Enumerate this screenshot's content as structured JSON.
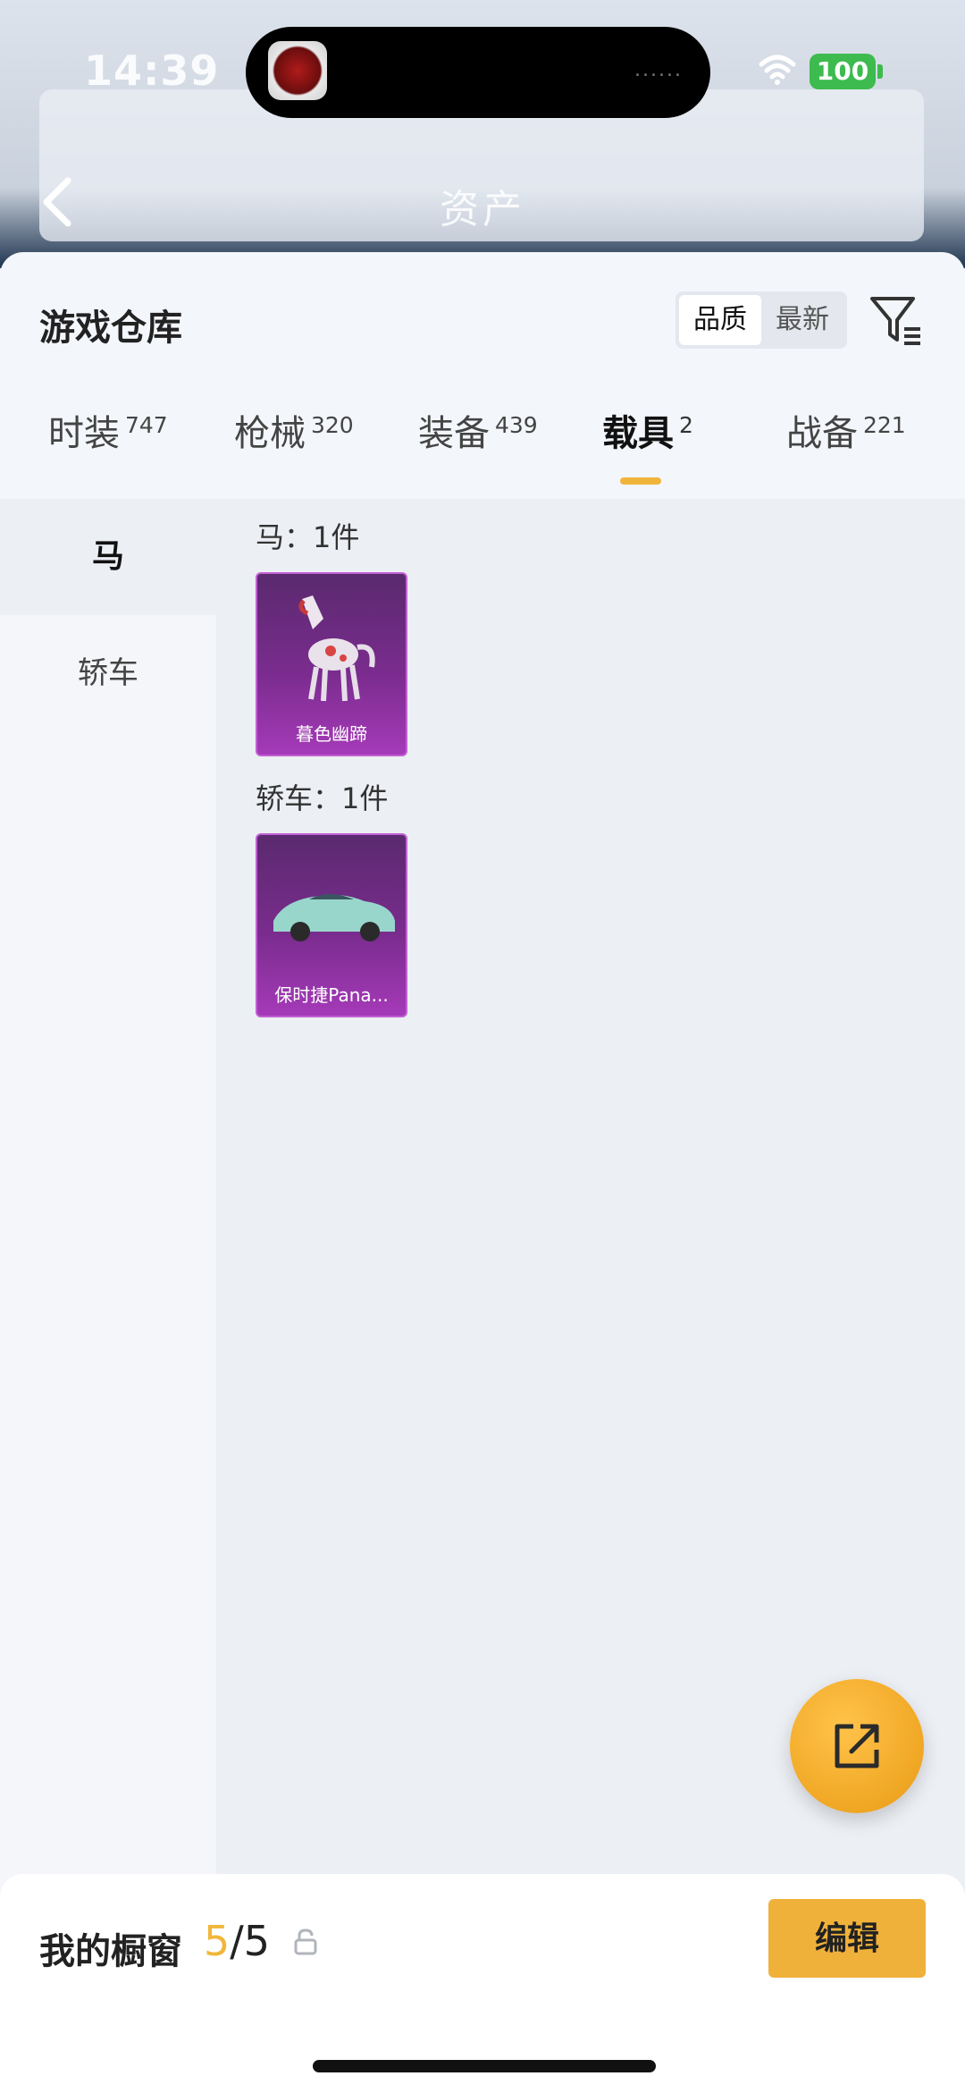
{
  "status": {
    "time": "14:39",
    "battery": "100",
    "island_dots": "......"
  },
  "background": {
    "title": "资产"
  },
  "sheet": {
    "title": "游戏仓库",
    "sort_options": [
      "品质",
      "最新"
    ],
    "tabs": [
      {
        "label": "时装",
        "count": "747"
      },
      {
        "label": "枪械",
        "count": "320"
      },
      {
        "label": "装备",
        "count": "439"
      },
      {
        "label": "载具",
        "count": "2"
      },
      {
        "label": "战备",
        "count": "221"
      }
    ],
    "side_items": [
      "马",
      "轿车"
    ],
    "groups": [
      {
        "label": "马：1件",
        "item_name": "暮色幽蹄"
      },
      {
        "label": "轿车：1件",
        "item_name": "保时捷Pana..."
      }
    ]
  },
  "footer": {
    "label": "我的橱窗",
    "count_current": "5",
    "count_total": "/5",
    "edit_label": "编辑"
  },
  "colors": {
    "accent": "#f0b13a",
    "card_purple": "#7a2c8e",
    "battery": "#3dbb4e"
  }
}
